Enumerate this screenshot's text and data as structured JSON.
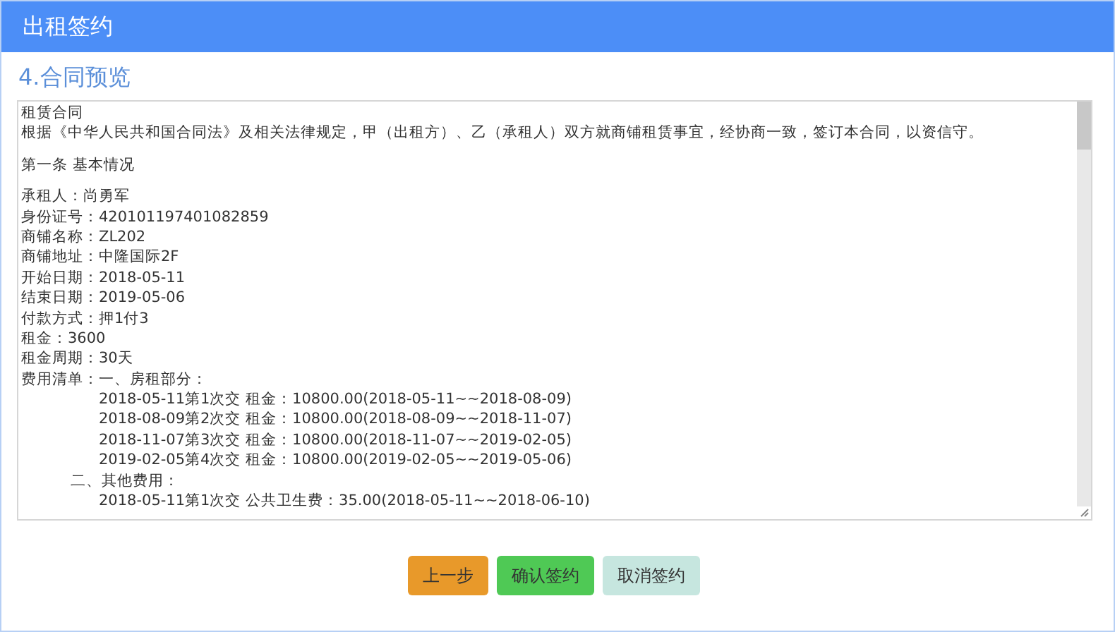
{
  "window": {
    "title": "出租签约"
  },
  "section_title": "4.合同预览",
  "contract": {
    "title": "租赁合同",
    "preamble": "根据《中华人民共和国合同法》及相关法律规定，甲（出租方）、乙（承租人）双方就商铺租赁事宜，经协商一致，签订本合同，以资信守。",
    "article": "第一条 基本情况",
    "fields": [
      {
        "label": "承租人：",
        "value": "尚勇军"
      },
      {
        "label": "身份证号：",
        "value": "420101197401082859"
      },
      {
        "label": "商铺名称：",
        "value": "ZL202"
      },
      {
        "label": "商铺地址：",
        "value": "中隆国际2F"
      },
      {
        "label": "开始日期：",
        "value": "2018-05-11"
      },
      {
        "label": "结束日期：",
        "value": "2019-05-06"
      },
      {
        "label": "付款方式：",
        "value": "押1付3"
      },
      {
        "label": "租金：",
        "value": "3600"
      },
      {
        "label": "租金周期：",
        "value": "30天"
      }
    ],
    "fee_list": {
      "label": "费用清单：",
      "sections": [
        {
          "title": "一、房租部分：",
          "items": [
            "2018-05-11第1次交 租金：10800.00(2018-05-11~~2018-08-09)",
            "2018-08-09第2次交 租金：10800.00(2018-08-09~~2018-11-07)",
            "2018-11-07第3次交 租金：10800.00(2018-11-07~~2019-02-05)",
            "2019-02-05第4次交 租金：10800.00(2019-02-05~~2019-05-06)"
          ]
        },
        {
          "title": "二、其他费用：",
          "items": [
            "2018-05-11第1次交 公共卫生费：35.00(2018-05-11~~2018-06-10)"
          ]
        }
      ]
    }
  },
  "buttons": [
    {
      "label": "上一步",
      "kind": "back"
    },
    {
      "label": "确认签约",
      "kind": "confirm"
    },
    {
      "label": "取消签约",
      "kind": "cancel"
    }
  ]
}
